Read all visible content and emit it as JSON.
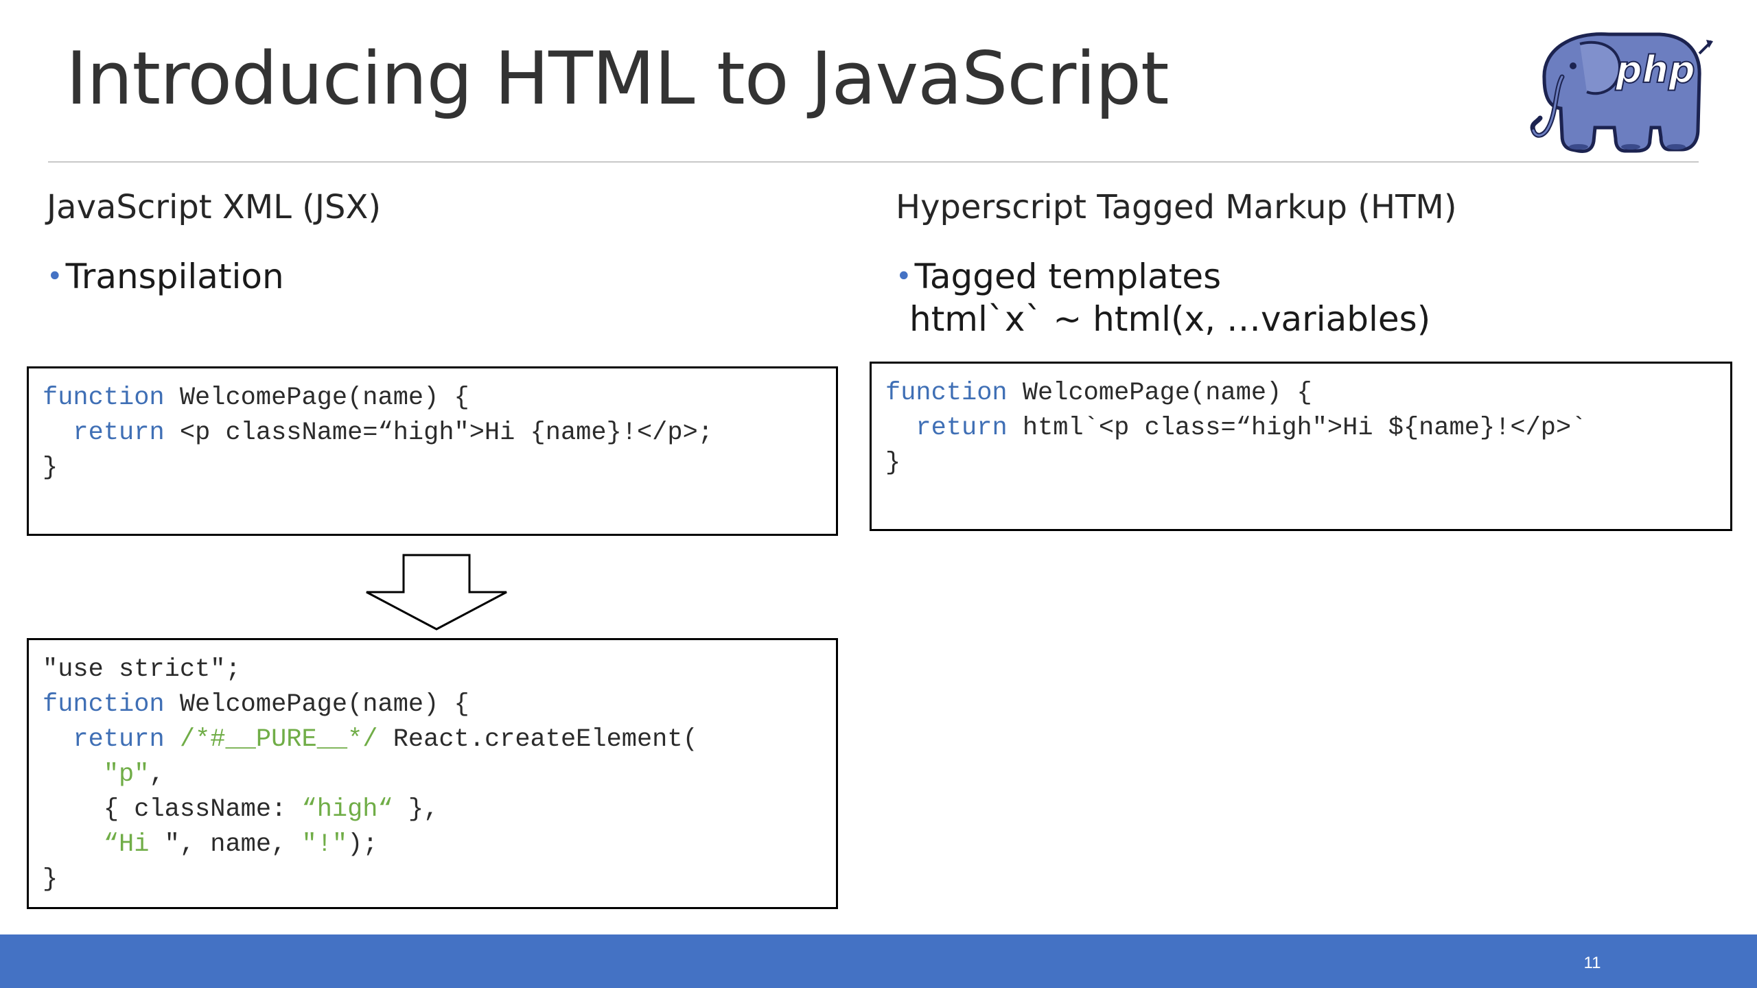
{
  "slide": {
    "title": "Introducing HTML to JavaScript",
    "page_number": "11",
    "logo_text": "php"
  },
  "left_column": {
    "heading": "JavaScript XML (JSX)",
    "bullet_marker": "•",
    "bullet": "Transpilation",
    "source_code": {
      "line1_kw": "function",
      "line1_rest": " WelcomePage(name) {",
      "line2_indent": "  ",
      "line2_kw": "return",
      "line2_rest": " <p className=“high\">Hi {name}!</p>;",
      "line3": "}"
    },
    "compiled_code": {
      "line1": "\"use strict\";",
      "line2_kw": "function",
      "line2_rest": " WelcomePage(name) {",
      "line3_indent": "  ",
      "line3_kw": "return",
      "line3_comment": " /*#__PURE__*/",
      "line3_rest": " React.createElement(",
      "line4_indent": "    ",
      "line4_str": "\"p\"",
      "line4_rest": ",",
      "line5_indent": "    ",
      "line5_pre": "{ className: ",
      "line5_str": "“high“",
      "line5_post": " },",
      "line6_indent": "    ",
      "line6_str": "“Hi ",
      "line6_mid": "\", name, ",
      "line6_str2": "\"!\"",
      "line6_post": ");",
      "line7": "}"
    }
  },
  "right_column": {
    "heading": "Hyperscript Tagged Markup (HTM)",
    "bullet_marker": "•",
    "bullet": "Tagged templates",
    "bullet_sub": "html`x` ~ html(x, …variables)",
    "source_code": {
      "line1_kw": "function",
      "line1_rest": " WelcomePage(name) {",
      "line2_indent": "  ",
      "line2_kw": "return",
      "line2_rest": " html`<p class=“high\">Hi ${name}!</p>`",
      "line3": "}"
    }
  },
  "colors": {
    "accent": "#4472c4",
    "keyword": "#3f6fb5",
    "string": "#70ad47"
  }
}
